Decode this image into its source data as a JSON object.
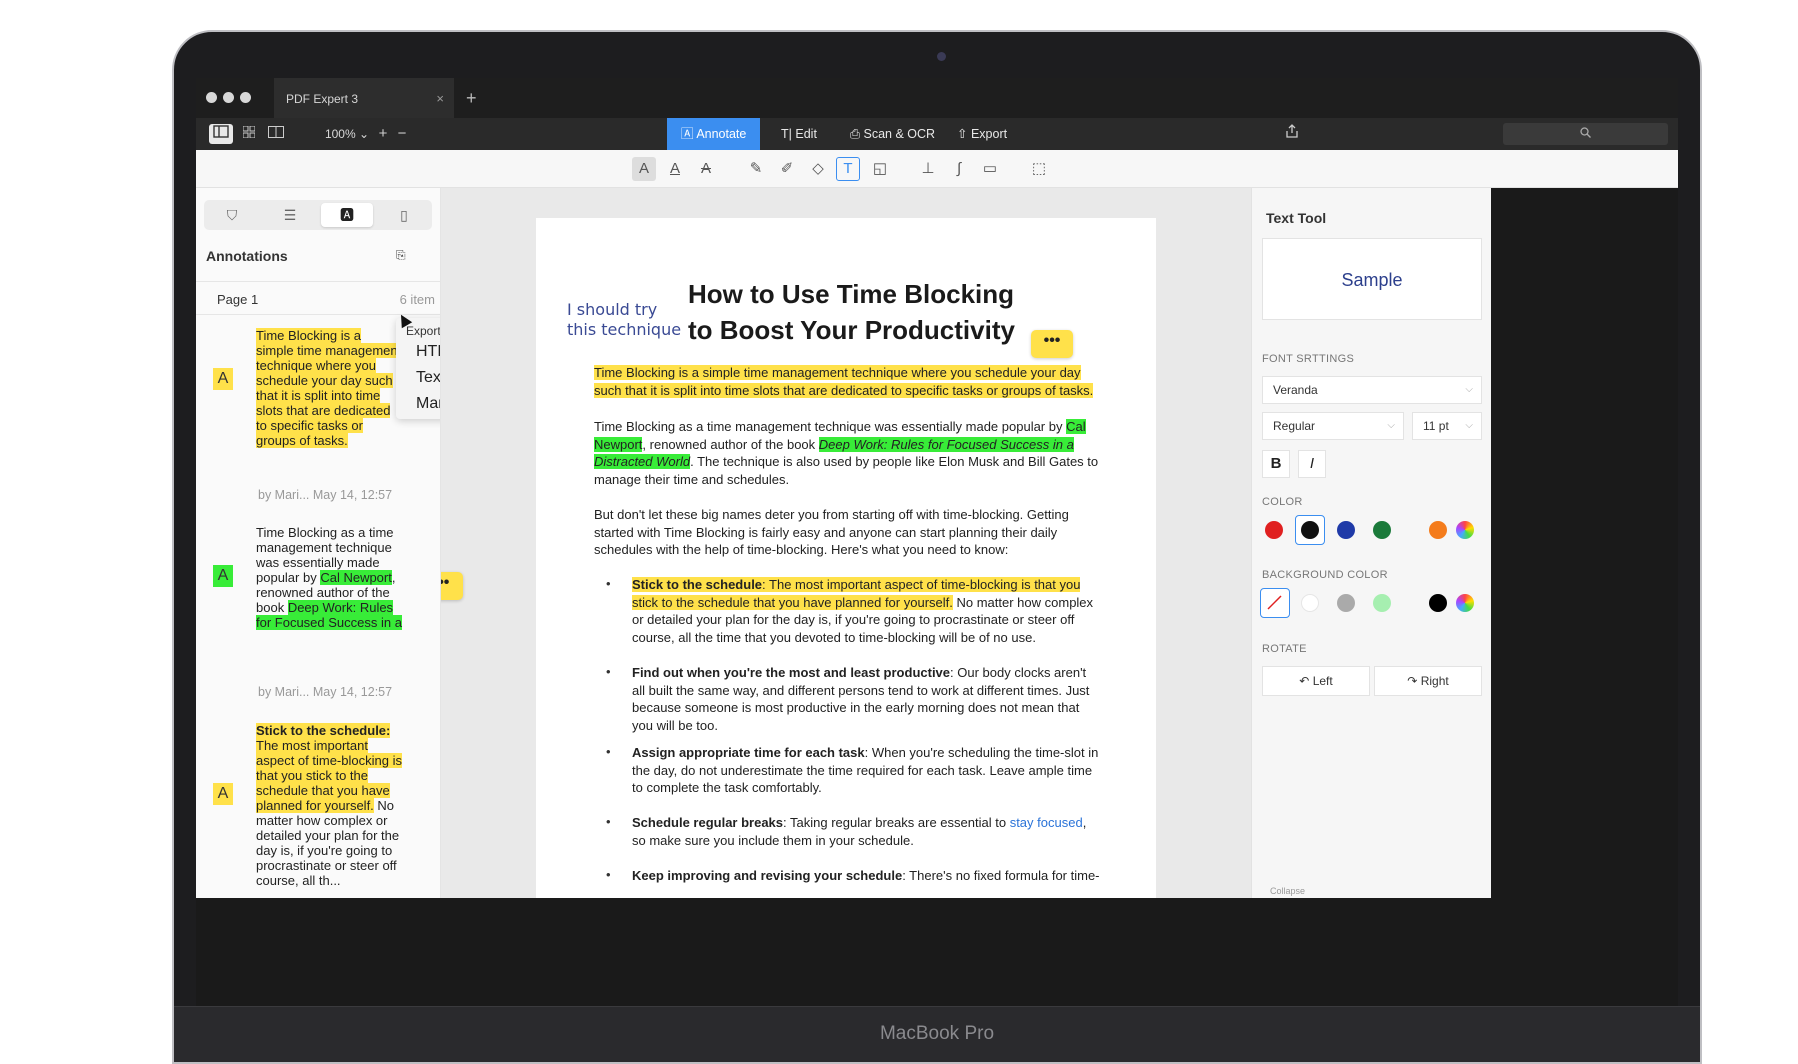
{
  "device": {
    "label": "MacBook Pro"
  },
  "window": {
    "tab_title": "PDF Expert 3",
    "tab_close": "×",
    "tab_add": "+"
  },
  "toolbar": {
    "zoom": "100%",
    "zoom_in": "+",
    "zoom_out": "−",
    "modes": [
      {
        "label": "Annotate",
        "icon": "annotate-icon"
      },
      {
        "label": "Edit",
        "icon": "text-cursor-icon"
      },
      {
        "label": "Scan & OCR",
        "icon": "scan-icon"
      },
      {
        "label": "Export",
        "icon": "export-icon"
      }
    ],
    "search_icon": "search-icon"
  },
  "annotation_tools": [
    "highlight-text-icon",
    "underline-text-icon",
    "strikethrough-text-icon",
    "pen-icon",
    "highlighter-icon",
    "eraser-icon",
    "text-box-icon",
    "shapes-icon",
    "stamp-icon",
    "signature-icon",
    "comment-icon",
    "selection-icon"
  ],
  "sidebar": {
    "tabs": [
      "bookmark-icon",
      "outline-icon",
      "annotations-icon",
      "page-icon"
    ],
    "title": "Annotations",
    "page_label": "Page 1",
    "page_count": "6 item",
    "items": [
      {
        "badge": "A",
        "text": "Time Blocking is a simple time management technique where you schedule your day such that it is split into time slots that are dedicated to specific tasks or groups of tasks.",
        "meta": "by Mari... May 14, 12:57"
      },
      {
        "badge": "A",
        "text_plain_1": "Time Blocking as a time management technique was essentially made popular by ",
        "text_hl_1": "Cal Newport",
        "text_plain_2": ", renowned author of the book ",
        "text_hl_2": "Deep Work: Rules for Focused Success in a",
        "meta": "by Mari... May 14, 12:57"
      },
      {
        "badge": "A",
        "bold": "Stick to the schedule:",
        "hl": "The most important aspect of time-blocking is that you stick to the schedule that you have planned for yourself.",
        "rest": "No matter how complex or detailed your plan for the day is, if you're going to procrastinate or steer off course, all th..."
      }
    ]
  },
  "export_popup": {
    "title": "Export Annotations as",
    "options": [
      "HTML",
      "Text",
      "Markdown"
    ]
  },
  "document": {
    "margin_note_1": "I should try",
    "margin_note_2": "this technique",
    "title_1": "How to Use Time Blocking",
    "title_2": "to Boost Your Productivity",
    "comment": "•••",
    "p1": "Time Blocking is a simple time management technique where you schedule your day such that it is split into time slots that are dedicated to specific tasks or groups of tasks.",
    "p2_a": "Time Blocking as a time management technique was essentially made popular by ",
    "p2_hl": "Cal Newport",
    "p2_b": ", renowned author of the book ",
    "p2_book": "Deep Work: Rules for Focused Success in a Distracted World",
    "p2_c": ". The technique is also used by people like Elon Musk and Bill Gates to manage their time and schedules.",
    "p3": "But don't let these big names deter you from starting off with time-blocking. Getting started with Time Blocking is fairly easy and anyone can start planning their daily schedules with the help of time-blocking. Here's what you need to know:",
    "bullets": [
      {
        "bold": "Stick to the schedule",
        "hl": ": The most important aspect of time-blocking is that you stick to the schedule that you have planned for yourself.",
        "rest": " No matter how complex or detailed your plan for the day is, if you're going to procrastinate or steer off course, all the time that you devoted to time-blocking will be of no use."
      },
      {
        "bold": "Find out when you're the most and least productive",
        "rest": ": Our body clocks aren't all built the same way, and different persons tend to work at different times. Just because someone is most productive in the early morning does not mean that you will be too."
      },
      {
        "bold": "Assign appropriate time for each task",
        "rest": ": When you're scheduling the time-slot in the day, do not underestimate the time required for each task. Leave ample time to complete the task comfortably."
      },
      {
        "bold": "Schedule regular breaks",
        "rest_a": ": Taking regular breaks are essential to ",
        "link": "stay focused",
        "rest_b": ", so make sure you include them in your schedule."
      },
      {
        "bold": "Keep improving and revising your schedule",
        "rest": ": There's no fixed formula for time-"
      }
    ],
    "bullet_mark": "•"
  },
  "right_panel": {
    "title": "Text Tool",
    "sample": "Sample",
    "font_settings_label": "FONT SRTTINGS",
    "font": "Veranda",
    "style": "Regular",
    "size": "11 pt",
    "bold": "B",
    "italic": "I",
    "color_label": "COLOR",
    "colors": [
      "#e02020",
      "#111111",
      "#1f3aa8",
      "#1b7a3a",
      "#f47c1c"
    ],
    "bg_label": "BACKGROUND COLOR",
    "bg_colors": [
      "#ffffff",
      "#aaaaaa",
      "#a6efb0",
      "#000000"
    ],
    "rotate_label": "ROTATE",
    "rotate_left": "Left",
    "rotate_right": "Right",
    "collapse": "Collapse"
  }
}
